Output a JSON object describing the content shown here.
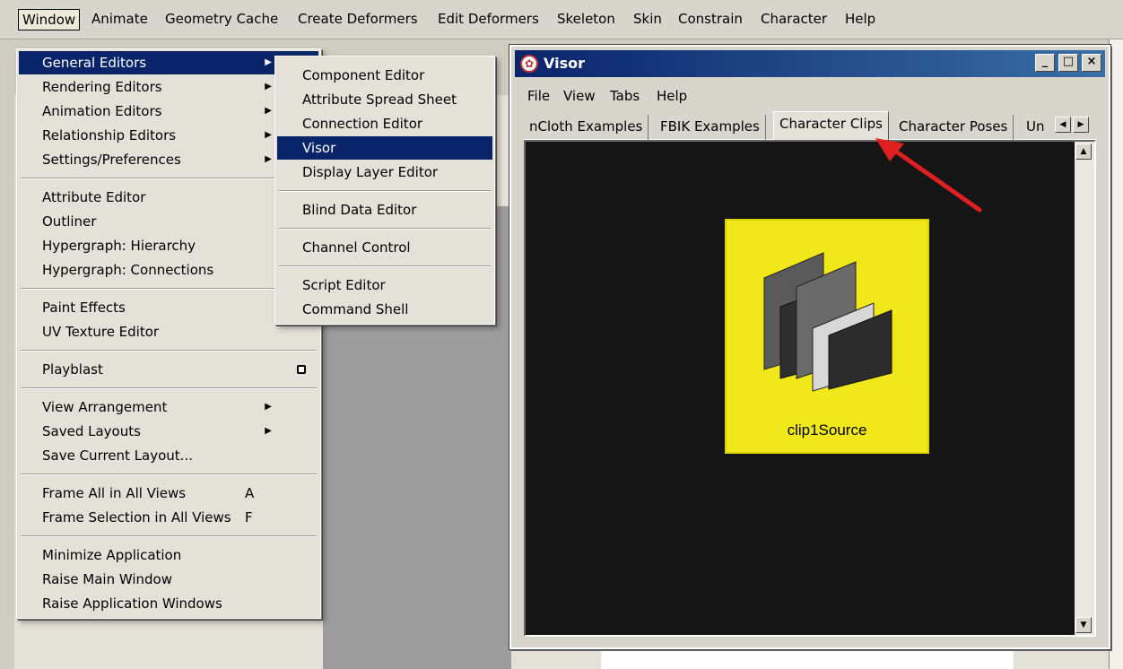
{
  "menubar": {
    "items": [
      "Window",
      "Animate",
      "Geometry Cache",
      "Create Deformers",
      "Edit Deformers",
      "Skeleton",
      "Skin",
      "Constrain",
      "Character",
      "Help"
    ]
  },
  "window_menu": {
    "items": [
      {
        "label": "General Editors",
        "submenu": true,
        "highlight": true
      },
      {
        "label": "Rendering Editors",
        "submenu": true
      },
      {
        "label": "Animation Editors",
        "submenu": true
      },
      {
        "label": "Relationship Editors",
        "submenu": true
      },
      {
        "label": "Settings/Preferences",
        "submenu": true
      },
      {
        "label": "Attribute Editor"
      },
      {
        "label": "Outliner"
      },
      {
        "label": "Hypergraph: Hierarchy"
      },
      {
        "label": "Hypergraph: Connections"
      },
      {
        "label": "Paint Effects"
      },
      {
        "label": "UV Texture Editor"
      },
      {
        "label": "Playblast",
        "option_box": true
      },
      {
        "label": "View Arrangement",
        "submenu": true
      },
      {
        "label": "Saved Layouts",
        "submenu": true
      },
      {
        "label": "Save Current Layout..."
      },
      {
        "label": "Frame All in All Views",
        "shortcut": "A"
      },
      {
        "label": "Frame Selection in All Views",
        "shortcut": "F"
      },
      {
        "label": "Minimize Application"
      },
      {
        "label": "Raise Main Window"
      },
      {
        "label": "Raise Application Windows"
      }
    ]
  },
  "general_editors_submenu": {
    "items": [
      "Component Editor",
      "Attribute Spread Sheet",
      "Connection Editor",
      "Visor",
      "Display Layer Editor",
      "Blind Data Editor",
      "Channel Control",
      "Script Editor",
      "Command Shell"
    ],
    "highlighted": "Visor"
  },
  "visor": {
    "title": "Visor",
    "menubar": [
      "File",
      "View",
      "Tabs",
      "Help"
    ],
    "tabs": [
      "nCloth Examples",
      "FBIK Examples",
      "Character Clips",
      "Character Poses",
      "Un"
    ],
    "selected_tab": "Character Clips",
    "clip_label": "clip1Source",
    "window_buttons": {
      "minimize": "_",
      "maximize": "□",
      "close": "×"
    }
  },
  "colors": {
    "title_bar": "#0a246a",
    "highlight": "#0a246a",
    "clip_tile": "#f0e81a",
    "pane_bg": "#151515",
    "annotation_arrow": "#e02020"
  }
}
